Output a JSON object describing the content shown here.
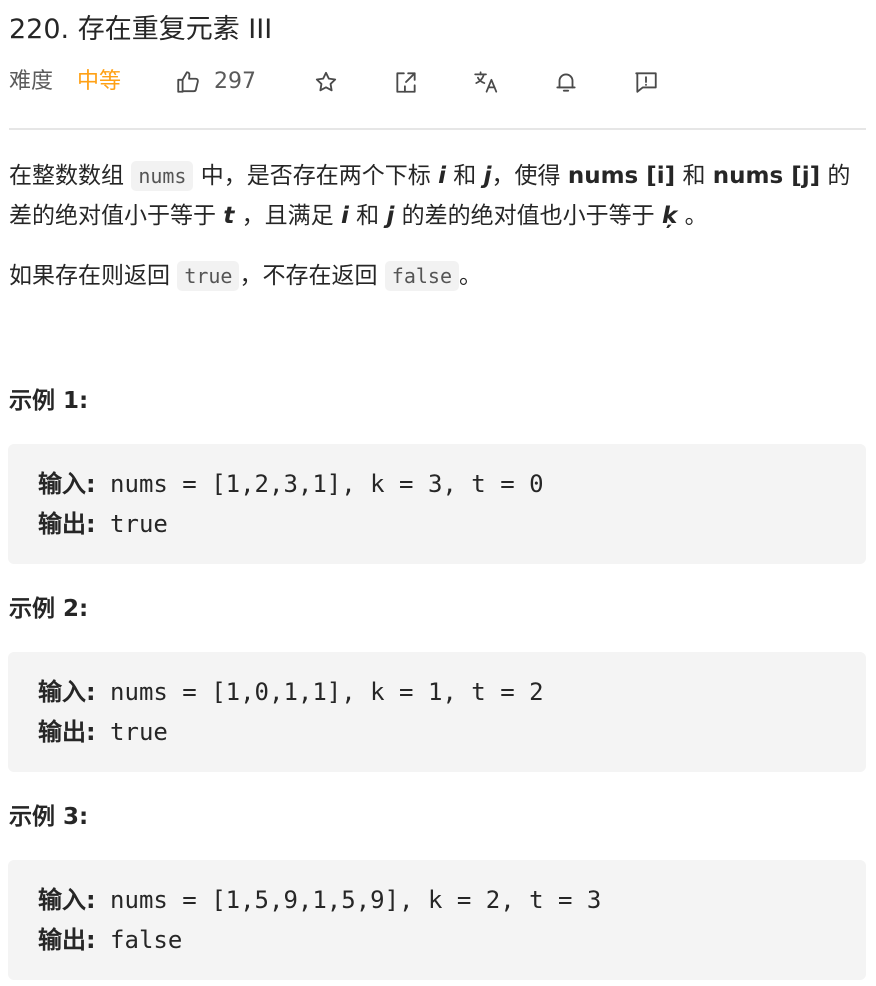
{
  "problem": {
    "title": "220. 存在重复元素 III",
    "difficulty_label": "难度",
    "difficulty_value": "中等",
    "likes": "297"
  },
  "icons": [
    "thumbs-up-icon",
    "star-icon",
    "share-icon",
    "translate-icon",
    "bell-icon",
    "feedback-icon"
  ],
  "colors": {
    "difficulty_medium": "#ffa116",
    "code_bg": "#f4f4f4",
    "divider": "#e6e6e6"
  },
  "description": {
    "p1": {
      "a": "在整数数组 ",
      "code_nums": "nums",
      "b": " 中，是否存在两个下标 ",
      "i": "i",
      "c": " 和 ",
      "j": "j",
      "d": "，使得 ",
      "expr1": "nums [i]",
      "e": " 和 ",
      "expr2": "nums [j]",
      "f": " 的差的绝对值小于等于 ",
      "t": "t",
      "g": " ，且满足 ",
      "i2": "i",
      "h": " 和 ",
      "j2": "j",
      "k_text": " 的差的绝对值也小于等于 ",
      "k": "ķ",
      "end": " 。"
    },
    "p2": {
      "a": "如果存在则返回 ",
      "code_true": "true",
      "b": "，不存在返回 ",
      "code_false": "false",
      "end": "。"
    }
  },
  "examples": [
    {
      "heading": "示例 1:",
      "input_label": "输入:",
      "input": " nums = [1,2,3,1], k = 3, t = 0",
      "output_label": "输出:",
      "output": " true"
    },
    {
      "heading": "示例 2:",
      "input_label": "输入:",
      "input": " nums = [1,0,1,1], k = 1, t = 2",
      "output_label": "输出:",
      "output": " true"
    },
    {
      "heading": "示例 3:",
      "input_label": "输入:",
      "input": " nums = [1,5,9,1,5,9], k = 2, t = 3",
      "output_label": "输出:",
      "output": " false"
    }
  ]
}
